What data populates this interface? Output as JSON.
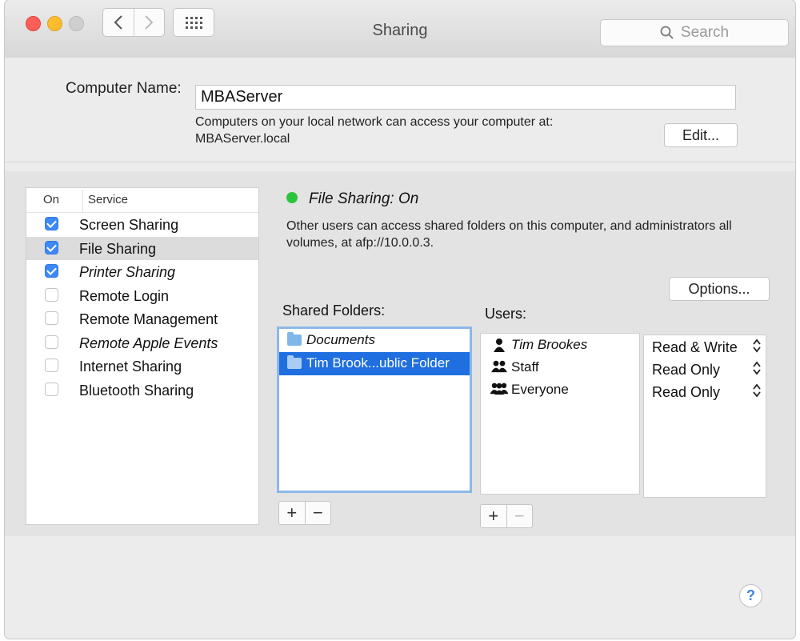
{
  "window": {
    "title": "Sharing",
    "search_placeholder": "Search"
  },
  "computer_name": {
    "label": "Computer Name:",
    "value": "MBAServer",
    "desc_line1": "Computers on your local network can access your computer at:",
    "desc_line2": "MBAServer.local",
    "edit_label": "Edit..."
  },
  "services": {
    "col_on": "On",
    "col_service": "Service",
    "items": [
      {
        "name": "Screen Sharing",
        "checked": true,
        "selected": false
      },
      {
        "name": "File Sharing",
        "checked": true,
        "selected": true
      },
      {
        "name": "Printer Sharing",
        "checked": true,
        "selected": false
      },
      {
        "name": "Remote Login",
        "checked": false,
        "selected": false
      },
      {
        "name": "Remote Management",
        "checked": false,
        "selected": false
      },
      {
        "name": "Remote Apple Events",
        "checked": false,
        "selected": false
      },
      {
        "name": "Internet Sharing",
        "checked": false,
        "selected": false
      },
      {
        "name": "Bluetooth Sharing",
        "checked": false,
        "selected": false
      }
    ]
  },
  "status": {
    "color": "#2dc43d",
    "title": "File Sharing: On",
    "description": "Other users can access shared folders on this computer, and administrators all volumes, at afp://10.0.0.3."
  },
  "options_label": "Options...",
  "shared_folders": {
    "label": "Shared Folders:",
    "items": [
      {
        "name": "Documents",
        "selected": false
      },
      {
        "name": "Tim Brook...ublic Folder",
        "selected": true
      }
    ],
    "add_label": "+",
    "remove_label": "−"
  },
  "users": {
    "label": "Users:",
    "items": [
      {
        "name": "Tim Brookes",
        "icon": "user-icon",
        "permission": "Read & Write"
      },
      {
        "name": "Staff",
        "icon": "group-icon",
        "permission": "Read Only"
      },
      {
        "name": "Everyone",
        "icon": "everyone-icon",
        "permission": "Read Only"
      }
    ],
    "add_label": "+",
    "remove_label": "−"
  },
  "help_label": "?"
}
